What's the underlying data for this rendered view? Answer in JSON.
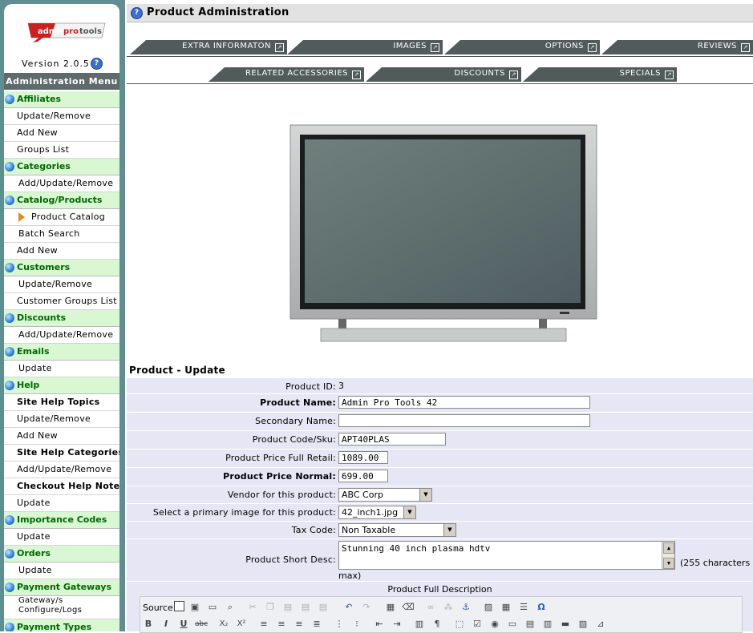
{
  "sidebar": {
    "logo_text": "adminprotools",
    "version": "Version 2.0.5",
    "menu_title": "Administration Menu",
    "sections": [
      {
        "title": "Affiliates",
        "items": [
          "Update/Remove",
          "Add New",
          "Groups List"
        ]
      },
      {
        "title": "Categories",
        "items": [
          "Add/Update/Remove"
        ]
      },
      {
        "title": "Catalog/Products",
        "items": [
          "Product Catalog",
          "Batch Search",
          "Add New"
        ]
      },
      {
        "title": "Customers",
        "items": [
          "Update/Remove",
          "Customer Groups List"
        ]
      },
      {
        "title": "Discounts",
        "items": [
          "Add/Update/Remove"
        ]
      },
      {
        "title": "Emails",
        "items": [
          "Update"
        ]
      },
      {
        "title": "Help",
        "items": [
          "Site Help Topics",
          "Update/Remove",
          "Add New",
          "Site Help Categories",
          "Add/Update/Remove",
          "Checkout Help Notes",
          "Update"
        ]
      },
      {
        "title": "Importance Codes",
        "items": [
          "Update"
        ]
      },
      {
        "title": "Orders",
        "items": [
          "Update"
        ]
      },
      {
        "title": "Payment Gateways",
        "items": [
          "Gateway/s",
          "Configure/Logs"
        ]
      },
      {
        "title": "Payment Types",
        "items": []
      }
    ]
  },
  "header": {
    "title": "Product Administration"
  },
  "tabs_row1": [
    "EXTRA INFORMATON",
    "IMAGES",
    "OPTIONS",
    "REVIEWS"
  ],
  "tabs_row2": [
    "RELATED ACCESSORIES",
    "DISCOUNTS",
    "SPECIALS"
  ],
  "form": {
    "heading": "Product - Update",
    "product_id_label": "Product ID:",
    "product_id": "3",
    "product_name_label": "Product Name:",
    "product_name": "Admin Pro Tools 42",
    "secondary_name_label": "Secondary Name:",
    "secondary_name": "",
    "sku_label": "Product Code/Sku:",
    "sku": "APT40PLAS",
    "price_retail_label": "Product Price Full Retail:",
    "price_retail": "1089.00",
    "price_normal_label": "Product Price Normal:",
    "price_normal": "699.00",
    "vendor_label": "Vendor for this product:",
    "vendor": "ABC Corp",
    "image_label": "Select a primary image for this product:",
    "image": "42_inch1.jpg",
    "tax_label": "Tax Code:",
    "tax": "Non Taxable",
    "short_desc_label": "Product Short Desc:",
    "short_desc": "Stunning 40 inch plasma hdtv",
    "short_desc_note": "(255 characters",
    "short_desc_note2": "max)",
    "full_desc_label": "Product Full Description"
  },
  "editor": {
    "source_label": "Source"
  }
}
